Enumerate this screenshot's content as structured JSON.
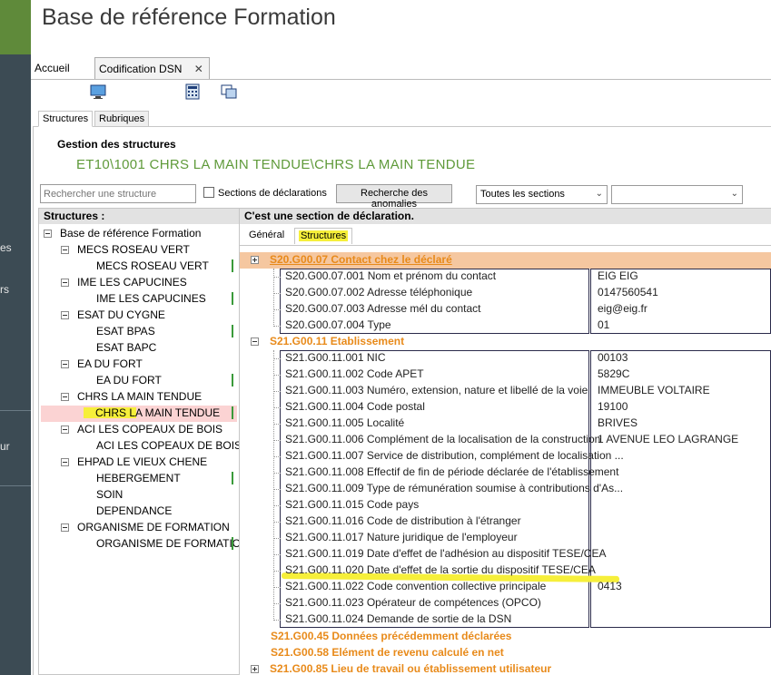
{
  "app": {
    "title": "Base de référence Formation"
  },
  "rail": {
    "frag1": "es",
    "frag2": "rs",
    "frag3": "ur"
  },
  "tabs": {
    "home": "Accueil",
    "dsn": "Codification DSN",
    "close": "✕"
  },
  "toolbar_icons": [
    "monitor-icon",
    "calculator-icon",
    "copy-screen-icon"
  ],
  "subtabs": [
    "Structures",
    "Rubriques"
  ],
  "management": {
    "title": "Gestion des structures",
    "path": "ET10\\1001 CHRS LA MAIN TENDUE\\CHRS LA MAIN TENDUE"
  },
  "filters": {
    "search_placeholder": "Rechercher une structure",
    "checkbox_label": "Sections de déclarations",
    "anomalies_button": "Recherche des anomalies",
    "sections_select": "Toutes les sections",
    "second_select": ""
  },
  "tree": {
    "header": "Structures :",
    "root": "Base de référence Formation",
    "groups": [
      {
        "label": "MECS ROSEAU VERT",
        "children": [
          "MECS ROSEAU VERT"
        ]
      },
      {
        "label": "IME LES CAPUCINES",
        "children": [
          "IME LES CAPUCINES"
        ]
      },
      {
        "label": "ESAT DU CYGNE",
        "children": [
          "ESAT BPAS",
          "ESAT BAPC"
        ]
      },
      {
        "label": "EA DU FORT",
        "children": [
          "EA DU FORT"
        ]
      },
      {
        "label": "CHRS LA MAIN TENDUE",
        "children": [
          "CHRS LA MAIN TENDUE"
        ]
      },
      {
        "label": "ACI LES COPEAUX DE BOIS",
        "children": [
          "ACI LES COPEAUX DE BOIS"
        ]
      },
      {
        "label": "EHPAD LE VIEUX CHENE",
        "children": [
          "HEBERGEMENT",
          "SOIN",
          "DEPENDANCE"
        ]
      },
      {
        "label": "ORGANISME DE FORMATION",
        "children": [
          "ORGANISME DE FORMATION"
        ]
      }
    ],
    "selected": "CHRS LA MAIN TENDUE"
  },
  "detail": {
    "header": "C'est une section de déclaration.",
    "tab_general": "Général",
    "tab_structures": "Structures",
    "sections": [
      {
        "code": "S20.G00.07 Contact chez le déclaré",
        "fields": [
          {
            "label": "S20.G00.07.001 Nom et prénom du contact",
            "value": "EIG EIG"
          },
          {
            "label": "S20.G00.07.002 Adresse téléphonique",
            "value": "0147560541"
          },
          {
            "label": "S20.G00.07.003 Adresse mél du contact",
            "value": "eig@eig.fr"
          },
          {
            "label": "S20.G00.07.004 Type",
            "value": "01"
          }
        ]
      },
      {
        "code": "S21.G00.11 Etablissement",
        "fields": [
          {
            "label": "S21.G00.11.001 NIC",
            "value": "00103"
          },
          {
            "label": "S21.G00.11.002 Code APET",
            "value": "5829C"
          },
          {
            "label": "S21.G00.11.003 Numéro, extension, nature et libellé de la voie",
            "value": "IMMEUBLE VOLTAIRE"
          },
          {
            "label": "S21.G00.11.004 Code postal",
            "value": "19100"
          },
          {
            "label": "S21.G00.11.005 Localité",
            "value": "BRIVES"
          },
          {
            "label": "S21.G00.11.006 Complément de la localisation de la construction",
            "value": "1 AVENUE LEO LAGRANGE"
          },
          {
            "label": "S21.G00.11.007 Service de distribution, complément de localisation ...",
            "value": ""
          },
          {
            "label": "S21.G00.11.008 Effectif de fin de période déclarée de l'établissement",
            "value": ""
          },
          {
            "label": "S21.G00.11.009 Type de rémunération soumise à contributions d'As...",
            "value": ""
          },
          {
            "label": "S21.G00.11.015 Code pays",
            "value": ""
          },
          {
            "label": "S21.G00.11.016 Code de distribution à l'étranger",
            "value": ""
          },
          {
            "label": "S21.G00.11.017 Nature juridique de l'employeur",
            "value": ""
          },
          {
            "label": "S21.G00.11.019 Date d'effet de l'adhésion au dispositif TESE/CEA",
            "value": ""
          },
          {
            "label": "S21.G00.11.020 Date d'effet de la sortie du dispositif TESE/CEA",
            "value": ""
          },
          {
            "label": "S21.G00.11.022 Code convention collective principale",
            "value": "0413"
          },
          {
            "label": "S21.G00.11.023 Opérateur de compétences (OPCO)",
            "value": ""
          },
          {
            "label": "S21.G00.11.024 Demande de sortie de la DSN",
            "value": ""
          }
        ]
      },
      {
        "code": "S21.G00.45 Données précédemment déclarées",
        "fields": []
      },
      {
        "code": "S21.G00.58 Elément de revenu calculé en net",
        "fields": []
      },
      {
        "code": "S21.G00.85 Lieu de travail ou établissement utilisateur",
        "fields": []
      }
    ]
  },
  "colors": {
    "accent_green": "#5f9a3a",
    "section_orange": "#e88a1a",
    "highlight_yellow": "#f6ef3a",
    "selected_pink": "#fbd3d3"
  }
}
